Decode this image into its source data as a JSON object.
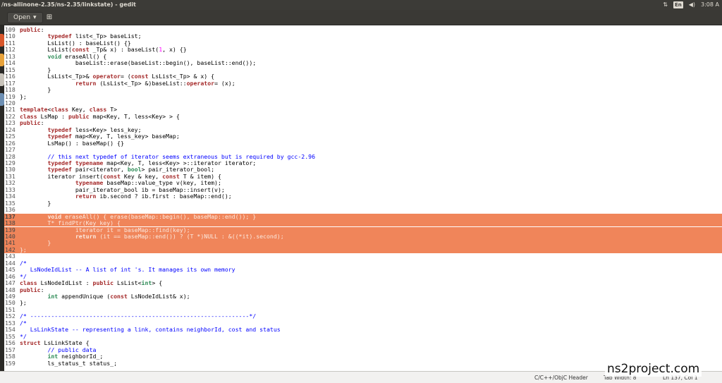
{
  "window": {
    "title": "/ns-allinone-2.35/ns-2.35/linkstate) - gedit"
  },
  "tray": {
    "keyboard": "En",
    "volume_icon": "volume-icon",
    "time": "3:08 A"
  },
  "toolbar": {
    "open_label": "Open",
    "open_icon": "chevron-down-icon",
    "new_icon": "new-document-icon"
  },
  "editor": {
    "current_line": 137,
    "highlight_color": "#f0855a",
    "lines": [
      {
        "n": "109",
        "segs": [
          [
            "kw",
            "public"
          ],
          [
            "txt",
            ":"
          ]
        ]
      },
      {
        "n": "110",
        "segs": [
          [
            "txt",
            "        "
          ],
          [
            "kw",
            "typedef"
          ],
          [
            "txt",
            " list<_Tp> baseList;"
          ]
        ]
      },
      {
        "n": "111",
        "segs": [
          [
            "txt",
            "        LsList() : baseList() {}"
          ]
        ]
      },
      {
        "n": "112",
        "segs": [
          [
            "txt",
            "        LsList("
          ],
          [
            "kw",
            "const"
          ],
          [
            "txt",
            " _Tp& x) : baseList("
          ],
          [
            "num",
            "1"
          ],
          [
            "txt",
            ", x) {}"
          ]
        ]
      },
      {
        "n": "113",
        "segs": [
          [
            "txt",
            "        "
          ],
          [
            "ty",
            "void"
          ],
          [
            "txt",
            " eraseAll() {"
          ]
        ]
      },
      {
        "n": "114",
        "segs": [
          [
            "txt",
            "                baseList::erase(baseList::begin(), baseList::end());"
          ]
        ]
      },
      {
        "n": "115",
        "segs": [
          [
            "txt",
            "        }"
          ]
        ]
      },
      {
        "n": "116",
        "segs": [
          [
            "txt",
            "        LsList<_Tp>& "
          ],
          [
            "kw",
            "operator"
          ],
          [
            "txt",
            "= ("
          ],
          [
            "kw",
            "const"
          ],
          [
            "txt",
            " LsList<_Tp> & x) {"
          ]
        ]
      },
      {
        "n": "117",
        "segs": [
          [
            "txt",
            "                "
          ],
          [
            "kw",
            "return"
          ],
          [
            "txt",
            " (LsList<_Tp> &)baseList::"
          ],
          [
            "kw",
            "operator"
          ],
          [
            "txt",
            "= (x);"
          ]
        ]
      },
      {
        "n": "118",
        "segs": [
          [
            "txt",
            "        }"
          ]
        ]
      },
      {
        "n": "119",
        "segs": [
          [
            "txt",
            "};"
          ]
        ]
      },
      {
        "n": "120",
        "segs": [
          [
            "txt",
            ""
          ]
        ]
      },
      {
        "n": "121",
        "segs": [
          [
            "kw",
            "template"
          ],
          [
            "txt",
            "<"
          ],
          [
            "kw",
            "class"
          ],
          [
            "txt",
            " Key, "
          ],
          [
            "kw",
            "class"
          ],
          [
            "txt",
            " T>"
          ]
        ]
      },
      {
        "n": "122",
        "segs": [
          [
            "kw",
            "class"
          ],
          [
            "txt",
            " LsMap : "
          ],
          [
            "kw",
            "public"
          ],
          [
            "txt",
            " map<Key, T, less<Key> > {"
          ]
        ]
      },
      {
        "n": "123",
        "segs": [
          [
            "kw",
            "public"
          ],
          [
            "txt",
            ":"
          ]
        ]
      },
      {
        "n": "124",
        "segs": [
          [
            "txt",
            "        "
          ],
          [
            "kw",
            "typedef"
          ],
          [
            "txt",
            " less<Key> less_key;"
          ]
        ]
      },
      {
        "n": "125",
        "segs": [
          [
            "txt",
            "        "
          ],
          [
            "kw",
            "typedef"
          ],
          [
            "txt",
            " map<Key, T, less_key> baseMap;"
          ]
        ]
      },
      {
        "n": "126",
        "segs": [
          [
            "txt",
            "        LsMap() : baseMap() {}"
          ]
        ]
      },
      {
        "n": "127",
        "segs": [
          [
            "txt",
            ""
          ]
        ]
      },
      {
        "n": "128",
        "segs": [
          [
            "txt",
            "        "
          ],
          [
            "cm",
            "// this next typedef of iterator seems extraneous but is required by gcc-2.96"
          ]
        ]
      },
      {
        "n": "129",
        "segs": [
          [
            "txt",
            "        "
          ],
          [
            "kw",
            "typedef"
          ],
          [
            "txt",
            " "
          ],
          [
            "kw",
            "typename"
          ],
          [
            "txt",
            " map<Key, T, less<Key> >::iterator iterator;"
          ]
        ]
      },
      {
        "n": "130",
        "segs": [
          [
            "txt",
            "        "
          ],
          [
            "kw",
            "typedef"
          ],
          [
            "txt",
            " pair<iterator, "
          ],
          [
            "ty",
            "bool"
          ],
          [
            "txt",
            "> pair_iterator_bool;"
          ]
        ]
      },
      {
        "n": "131",
        "segs": [
          [
            "txt",
            "        iterator insert("
          ],
          [
            "kw",
            "const"
          ],
          [
            "txt",
            " Key & key, "
          ],
          [
            "kw",
            "const"
          ],
          [
            "txt",
            " T & item) {"
          ]
        ]
      },
      {
        "n": "132",
        "segs": [
          [
            "txt",
            "                "
          ],
          [
            "kw",
            "typename"
          ],
          [
            "txt",
            " baseMap::value_type v(key, item);"
          ]
        ]
      },
      {
        "n": "133",
        "segs": [
          [
            "txt",
            "                pair_iterator_bool ib = baseMap::insert(v);"
          ]
        ]
      },
      {
        "n": "134",
        "segs": [
          [
            "txt",
            "                "
          ],
          [
            "kw",
            "return"
          ],
          [
            "txt",
            " ib.second ? ib.first : baseMap::end();"
          ]
        ]
      },
      {
        "n": "135",
        "segs": [
          [
            "txt",
            "        }"
          ]
        ]
      },
      {
        "n": "136",
        "segs": [
          [
            "txt",
            ""
          ]
        ]
      },
      {
        "n": "137",
        "hl": true,
        "segs": [
          [
            "txt",
            "        "
          ],
          [
            "ty",
            "void"
          ],
          [
            "txt",
            " eraseAll() { erase(baseMap::begin(), baseMap::end()); }"
          ]
        ]
      },
      {
        "n": "138",
        "hl": true,
        "segs": [
          [
            "txt",
            "        T* findPtr(Key key) {"
          ]
        ]
      },
      {
        "n": "139",
        "hl": true,
        "segs": [
          [
            "txt",
            "                iterator it = baseMap::find(key);"
          ]
        ]
      },
      {
        "n": "140",
        "hl": true,
        "segs": [
          [
            "txt",
            "                "
          ],
          [
            "kw",
            "return"
          ],
          [
            "txt",
            " (it == baseMap::end()) ? (T *)NULL : &((*it).second);"
          ]
        ]
      },
      {
        "n": "141",
        "hl": true,
        "segs": [
          [
            "txt",
            "        }"
          ]
        ]
      },
      {
        "n": "142",
        "hl": true,
        "segs": [
          [
            "txt",
            "};"
          ]
        ]
      },
      {
        "n": "143",
        "segs": [
          [
            "txt",
            ""
          ]
        ]
      },
      {
        "n": "144",
        "segs": [
          [
            "cm",
            "/*"
          ]
        ]
      },
      {
        "n": "145",
        "segs": [
          [
            "cm",
            "   LsNodeIdList -- A list of int 's. It manages its own memory"
          ]
        ]
      },
      {
        "n": "146",
        "segs": [
          [
            "cm",
            "*/"
          ]
        ]
      },
      {
        "n": "147",
        "segs": [
          [
            "kw",
            "class"
          ],
          [
            "txt",
            " LsNodeIdList : "
          ],
          [
            "kw",
            "public"
          ],
          [
            "txt",
            " LsList<"
          ],
          [
            "ty",
            "int"
          ],
          [
            "txt",
            "> {"
          ]
        ]
      },
      {
        "n": "148",
        "segs": [
          [
            "kw",
            "public"
          ],
          [
            "txt",
            ":"
          ]
        ]
      },
      {
        "n": "149",
        "segs": [
          [
            "txt",
            "        "
          ],
          [
            "ty",
            "int"
          ],
          [
            "txt",
            " appendUnique ("
          ],
          [
            "kw",
            "const"
          ],
          [
            "txt",
            " LsNodeIdList& x);"
          ]
        ]
      },
      {
        "n": "150",
        "segs": [
          [
            "txt",
            "};"
          ]
        ]
      },
      {
        "n": "151",
        "segs": [
          [
            "txt",
            ""
          ]
        ]
      },
      {
        "n": "152",
        "segs": [
          [
            "cm",
            "/* ---------------------------------------------------------------*/"
          ]
        ]
      },
      {
        "n": "153",
        "segs": [
          [
            "cm",
            "/*"
          ]
        ]
      },
      {
        "n": "154",
        "segs": [
          [
            "cm",
            "   LsLinkState -- representing a link, contains neighborId, cost and status"
          ]
        ]
      },
      {
        "n": "155",
        "segs": [
          [
            "cm",
            "*/"
          ]
        ]
      },
      {
        "n": "156",
        "segs": [
          [
            "kw",
            "struct"
          ],
          [
            "txt",
            " LsLinkState {"
          ]
        ]
      },
      {
        "n": "157",
        "segs": [
          [
            "txt",
            "        "
          ],
          [
            "cm",
            "// public data"
          ]
        ]
      },
      {
        "n": "158",
        "segs": [
          [
            "txt",
            "        "
          ],
          [
            "ty",
            "int"
          ],
          [
            "txt",
            " neighborId_;"
          ]
        ]
      },
      {
        "n": "159",
        "segs": [
          [
            "txt",
            "        ls_status_t status_;"
          ]
        ]
      }
    ]
  },
  "statusbar": {
    "language": "C/C++/ObjC Header",
    "tab_width": "Tab Width: 8",
    "position": "Ln 137, Col 1"
  },
  "watermark": "ns2project.com"
}
